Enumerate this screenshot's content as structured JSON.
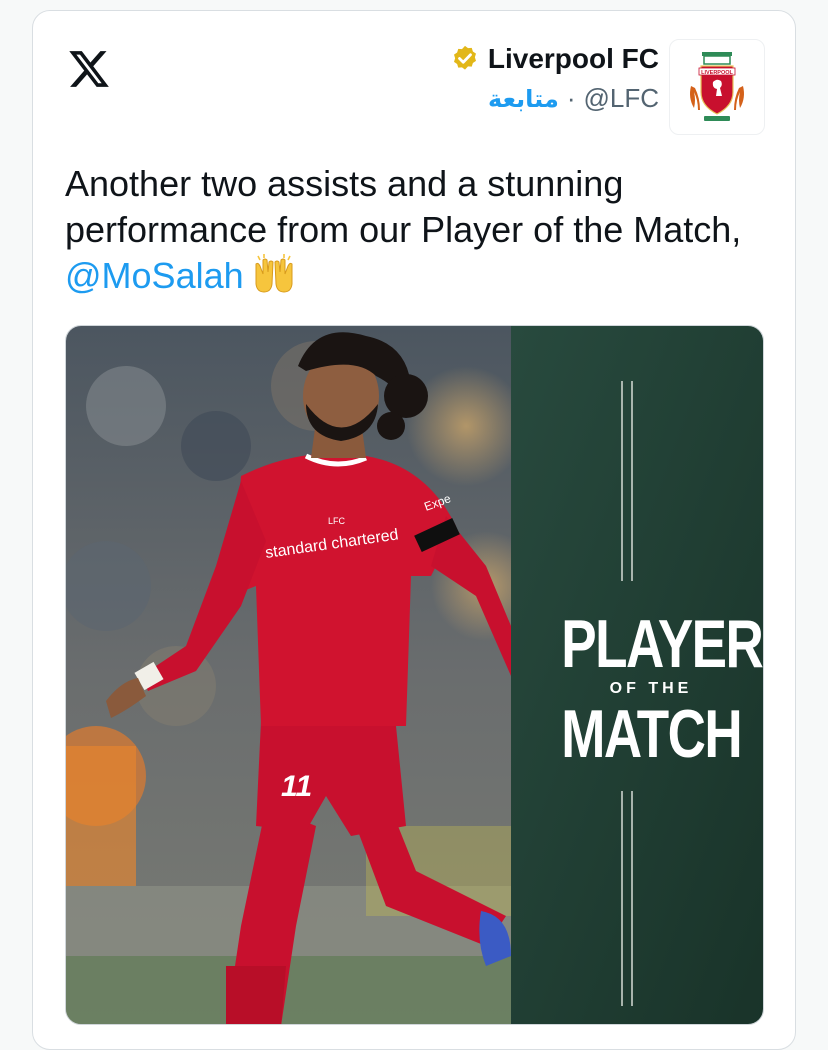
{
  "app": {
    "logo_icon": "x-logo-icon"
  },
  "author": {
    "display_name": "Liverpool FC",
    "handle": "@LFC",
    "separator": "·",
    "follow_label": "متابعة",
    "verified_icon": "verified-gold-badge-icon",
    "avatar_icon": "liverpool-crest-icon",
    "crest_text": "LIVERPOOL"
  },
  "tweet": {
    "text": "Another two assists and a stunning performance from our Player of the Match, ",
    "mention": "@MoSalah",
    "emoji_icon": "raising-hands-emoji-icon"
  },
  "media": {
    "graphic_line1": "PLAYER",
    "graphic_line2": "OF THE",
    "graphic_line3": "MATCH",
    "shirt_sponsor": "standard chartered",
    "shirt_number": "11",
    "sleeve_text": "Expe",
    "badge_text": "LFC"
  },
  "colors": {
    "accent_blue": "#1d9bf0",
    "panel_green": "#1f3b31",
    "kit_red": "#c8102e"
  }
}
